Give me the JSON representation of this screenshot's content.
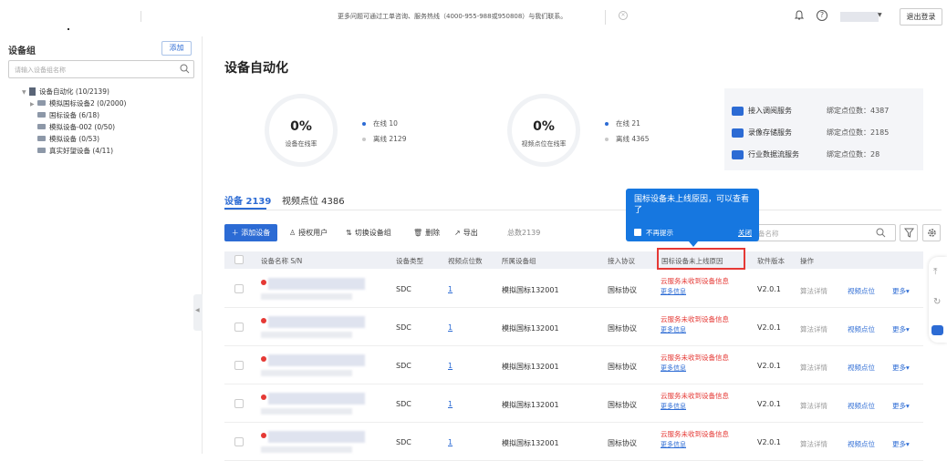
{
  "topbar": {
    "notice": "更多问题可通过工单咨询、服务热线（4000-955-988或950808）与我们联系。",
    "logout_label": "退出登录"
  },
  "sidebar": {
    "title": "设备组",
    "add_label": "添加",
    "search_placeholder": "请输入设备组名称",
    "tree": [
      {
        "label": "设备自动化 (10/2139)",
        "level": 0,
        "icon": "root-group-icon"
      },
      {
        "label": "模拟国标设备2 (0/2000)",
        "level": 1,
        "icon": "folder-icon"
      },
      {
        "label": "国标设备 (6/18)",
        "level": 1,
        "icon": "folder-icon"
      },
      {
        "label": "模拟设备-002 (0/50)",
        "level": 1,
        "icon": "folder-icon"
      },
      {
        "label": "模拟设备 (0/53)",
        "level": 1,
        "icon": "folder-icon"
      },
      {
        "label": "真实好望设备 (4/11)",
        "level": 1,
        "icon": "folder-icon"
      }
    ]
  },
  "main": {
    "title": "设备自动化",
    "stats": [
      {
        "pct": "0%",
        "label": "设备在线率",
        "online": "在线  10",
        "offline": "离线  2129"
      },
      {
        "pct": "0%",
        "label": "视频点位在线率",
        "online": "在线  21",
        "offline": "离线  4365"
      }
    ],
    "services": [
      {
        "name": "接入调阅服务",
        "count": "绑定点位数：4387",
        "icon": "access-service-icon"
      },
      {
        "name": "录像存储服务",
        "count": "绑定点位数：2185",
        "icon": "storage-service-icon"
      },
      {
        "name": "行业数据流服务",
        "count": "绑定点位数：28",
        "icon": "dataflow-service-icon"
      }
    ],
    "tabs": [
      {
        "label": "设备 2139",
        "active": true
      },
      {
        "label": "视频点位 4386",
        "active": false
      }
    ],
    "toolbar": {
      "add": "添加设备",
      "auth": "授权用户",
      "switch": "切换设备组",
      "delete": "删除",
      "export": "导出",
      "total": "总数2139",
      "search_placeholder": "备名称"
    },
    "columns": [
      "设备名称 S/N",
      "设备类型",
      "视频点位数",
      "所属设备组",
      "接入协议",
      "国标设备未上线原因",
      "软件版本",
      "操作"
    ],
    "rows": [
      {
        "type": "SDC",
        "points": "1",
        "group": "模拟国标132001",
        "protocol": "国标协议",
        "reason": "云服务未收到设备信息",
        "more_info": "更多信息",
        "version": "V2.0.1",
        "algo": "算法详情",
        "video": "视频点位",
        "more": "更多▾"
      },
      {
        "type": "SDC",
        "points": "1",
        "group": "模拟国标132001",
        "protocol": "国标协议",
        "reason": "云服务未收到设备信息",
        "more_info": "更多信息",
        "version": "V2.0.1",
        "algo": "算法详情",
        "video": "视频点位",
        "more": "更多▾"
      },
      {
        "type": "SDC",
        "points": "1",
        "group": "模拟国标132001",
        "protocol": "国标协议",
        "reason": "云服务未收到设备信息",
        "more_info": "更多信息",
        "version": "V2.0.1",
        "algo": "算法详情",
        "video": "视频点位",
        "more": "更多▾"
      },
      {
        "type": "SDC",
        "points": "1",
        "group": "模拟国标132001",
        "protocol": "国标协议",
        "reason": "云服务未收到设备信息",
        "more_info": "更多信息",
        "version": "V2.0.1",
        "algo": "算法详情",
        "video": "视频点位",
        "more": "更多▾"
      },
      {
        "type": "SDC",
        "points": "1",
        "group": "模拟国标132001",
        "protocol": "国标协议",
        "reason": "云服务未收到设备信息",
        "more_info": "更多信息",
        "version": "V2.0.1",
        "algo": "算法详情",
        "video": "视频点位",
        "more": "更多▾"
      }
    ]
  },
  "tooltip": {
    "text": "国标设备未上线原因，可以查看了",
    "no_remind": "不再提示",
    "close": "关闭"
  },
  "colors": {
    "accent": "#2c6bd4",
    "error": "#e53935",
    "tooltip": "#1677e0"
  }
}
